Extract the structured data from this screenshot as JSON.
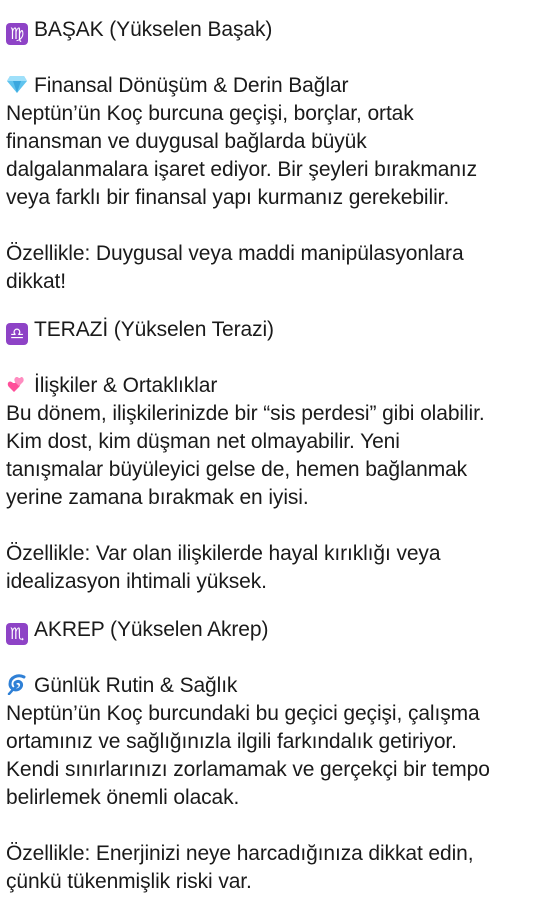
{
  "sections": [
    {
      "sign_icon": "virgo-icon",
      "sign_title": "BAŞAK (Yükselen Başak)",
      "topic_icon": "gem-icon",
      "topic_title": "Finansal Dönüşüm & Derin Bağlar",
      "body_lines": [
        "Neptün’ün Koç burcuna geçişi, borçlar, ortak",
        "finansman ve duygusal bağlarda büyük",
        "dalgalanmalara işaret ediyor. Bir şeyleri bırakmanız",
        "veya farklı bir finansal yapı kurmanız gerekebilir."
      ],
      "note_lines": [
        "Özellikle: Duygusal veya maddi manipülasyonlara",
        "dikkat!"
      ]
    },
    {
      "sign_icon": "libra-icon",
      "sign_title": "TERAZİ (Yükselen Terazi)",
      "topic_icon": "two-hearts-icon",
      "topic_title": "İlişkiler & Ortaklıklar",
      "body_lines": [
        "Bu dönem, ilişkilerinizde bir “sis perdesi” gibi olabilir.",
        "Kim dost, kim düşman net olmayabilir. Yeni",
        "tanışmalar büyüleyici gelse de, hemen bağlanmak",
        "yerine zamana bırakmak en iyisi."
      ],
      "note_lines": [
        "Özellikle: Var olan ilişkilerde hayal kırıklığı veya",
        "idealizasyon ihtimali yüksek."
      ]
    },
    {
      "sign_icon": "scorpio-icon",
      "sign_title": "AKREP (Yükselen Akrep)",
      "topic_icon": "cyclone-icon",
      "topic_title": "Günlük Rutin & Sağlık",
      "body_lines": [
        "Neptün’ün Koç burcundaki bu geçici geçişi, çalışma",
        "ortamınız ve sağlığınızla ilgili farkındalık getiriyor.",
        "Kendi sınırlarınızı zorlamamak ve gerçekçi bir tempo",
        "belirlemek önemli olacak."
      ],
      "note_lines": [
        "Özellikle: Enerjinizi neye harcadığınıza dikkat edin,",
        "çünkü tükenmişlik riski var."
      ]
    }
  ],
  "colors": {
    "text": "#1a1a1a",
    "zodiac_badge": "#8e43c6",
    "gem": "#5fc3ee",
    "hearts": "#ff4f9a",
    "cyclone": "#2f80d6"
  }
}
